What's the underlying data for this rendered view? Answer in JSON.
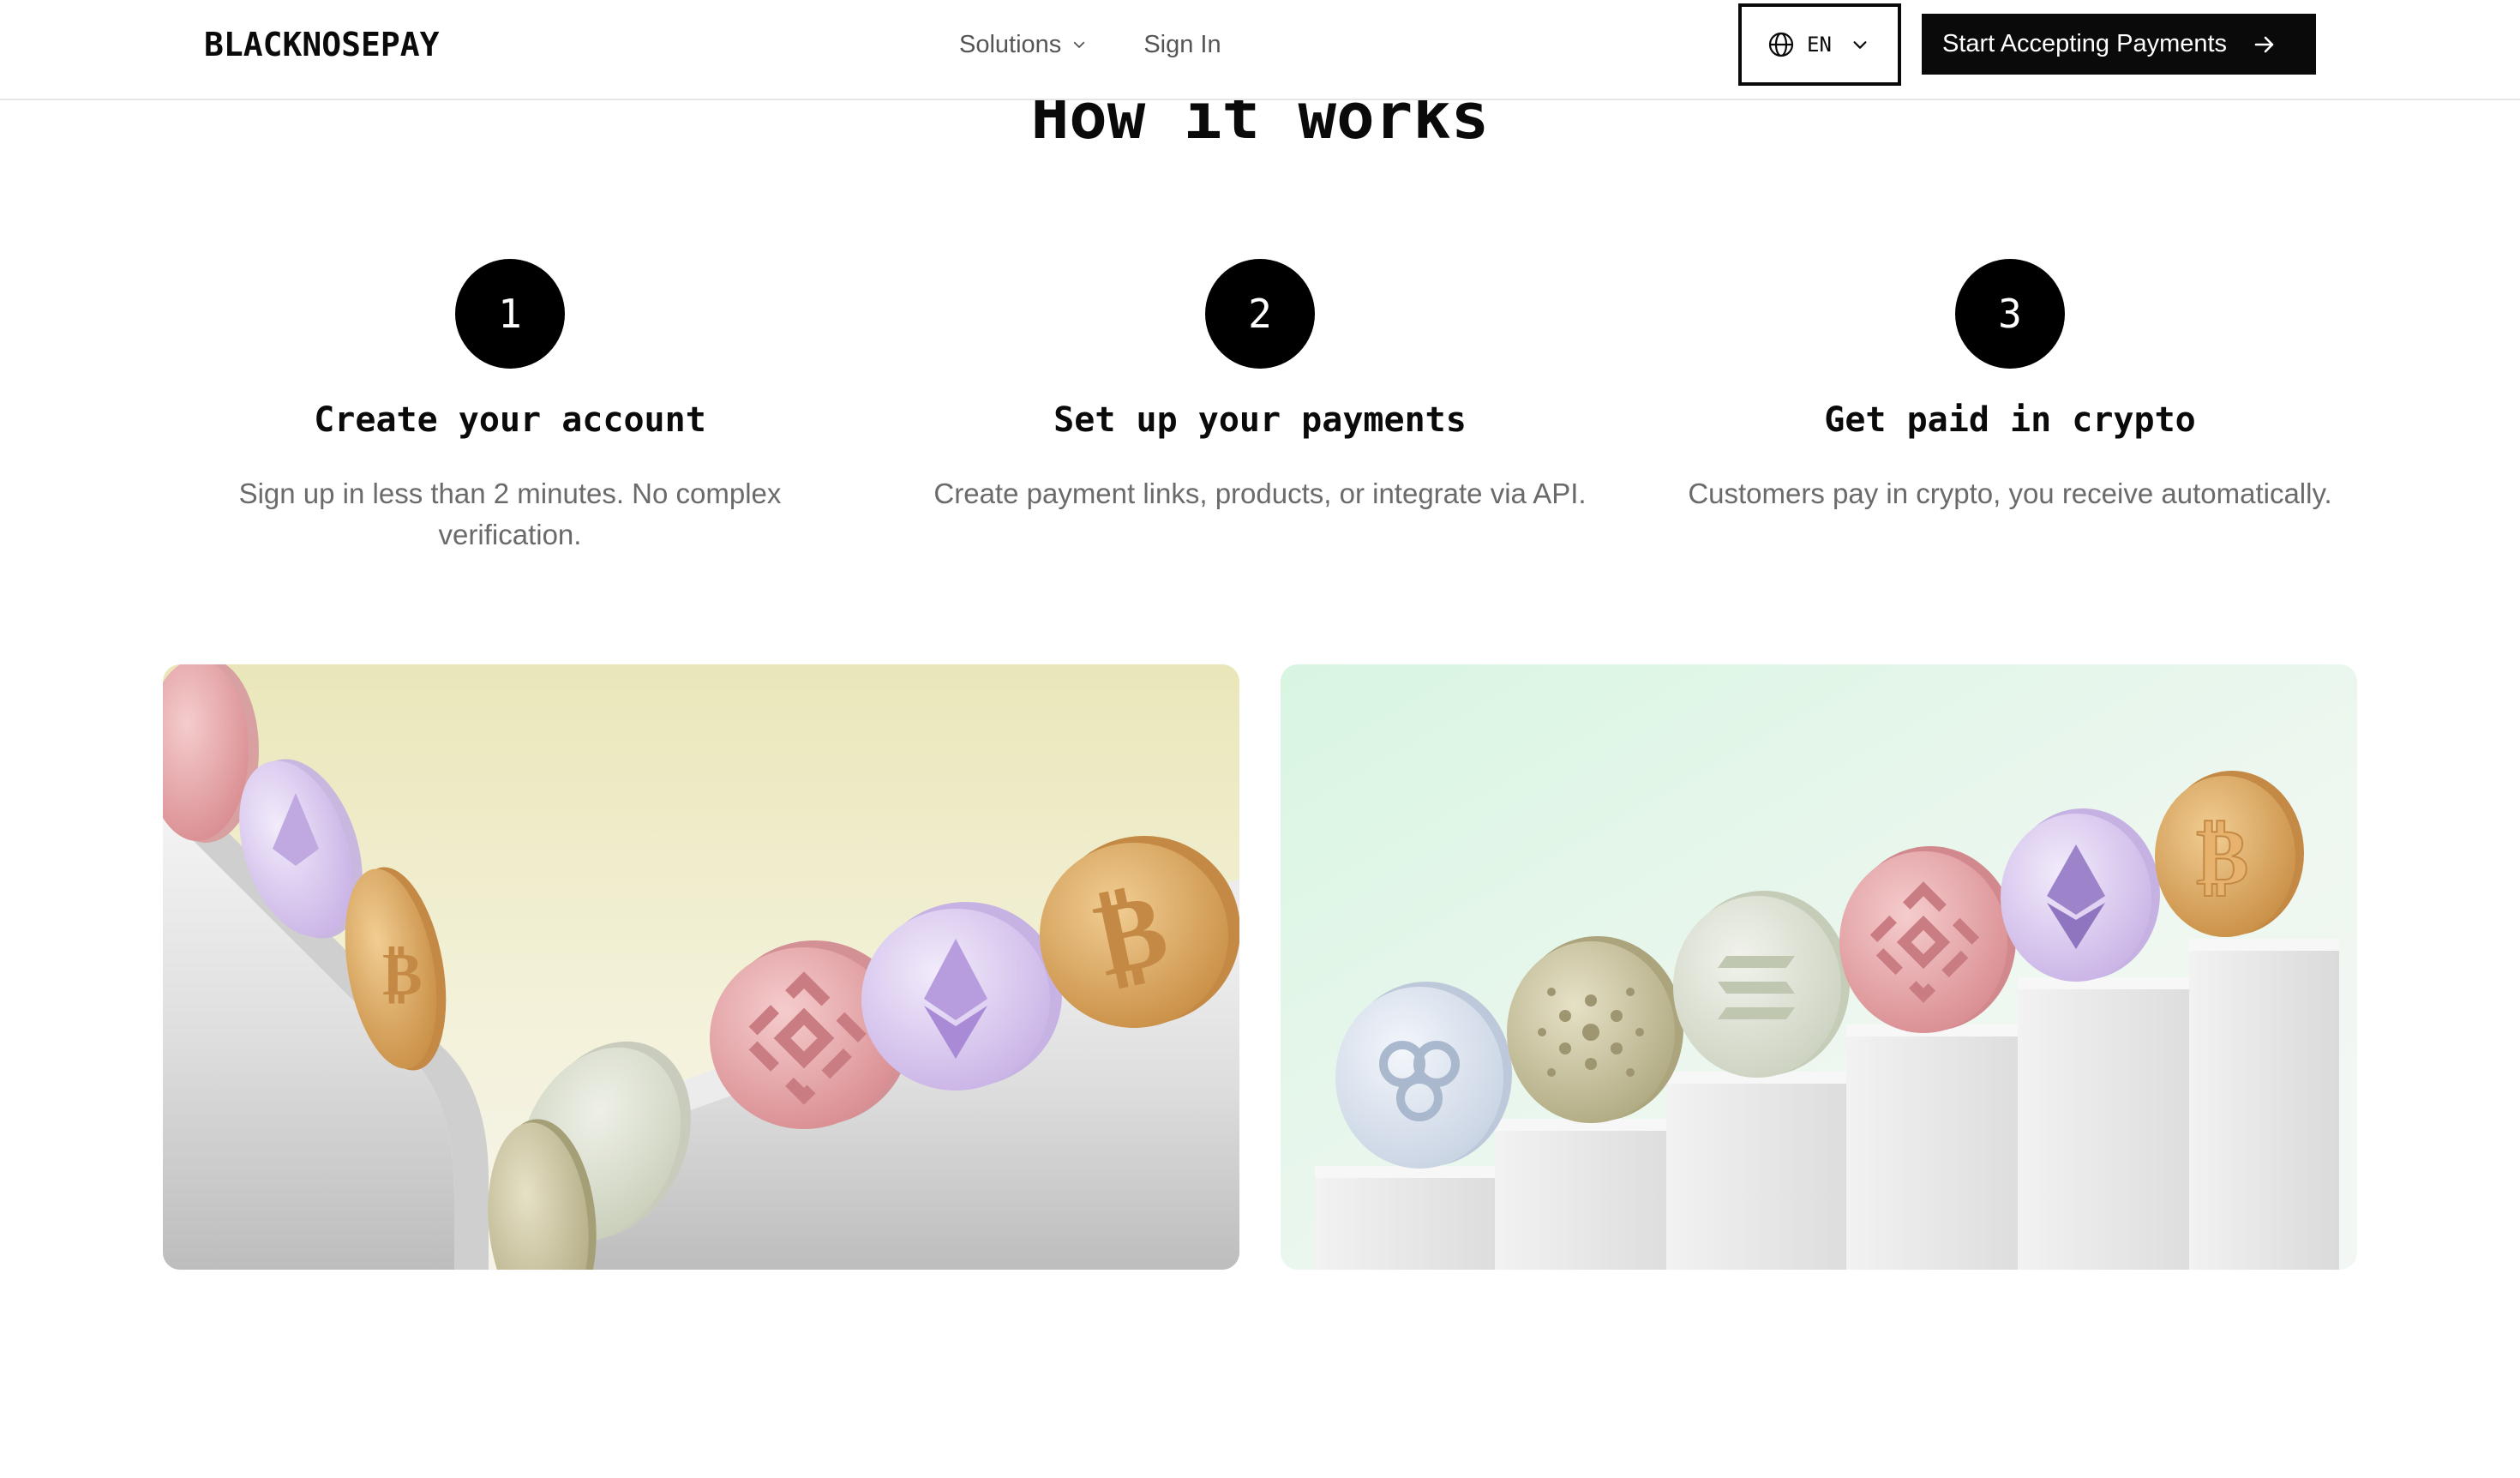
{
  "header": {
    "logo": "BLACKNOSEPAY",
    "nav": {
      "solutions_label": "Solutions",
      "signin_label": "Sign In"
    },
    "language": {
      "code": "EN",
      "icon": "globe-icon"
    },
    "cta_label": "Start Accepting Payments",
    "cta_icon": "arrow-right-icon"
  },
  "how_it_works": {
    "title": "How it works",
    "steps": [
      {
        "number": "1",
        "title": "Create your account",
        "description": "Sign up in less than 2 minutes. No complex verification."
      },
      {
        "number": "2",
        "title": "Set up your payments",
        "description": "Create payment links, products, or integrate via API."
      },
      {
        "number": "3",
        "title": "Get paid in crypto",
        "description": "Customers pay in crypto, you receive automatically."
      }
    ]
  },
  "illustrations": {
    "left": {
      "icon": "crypto-coins-on-slide-illustration",
      "colors": {
        "bg_top": "#e9e7b9",
        "bg_bottom": "#f6f4ea"
      }
    },
    "right": {
      "icon": "crypto-coins-on-podiums-illustration",
      "colors": {
        "bg_top": "#d8f5e2",
        "bg_bottom": "#f3f7f4"
      }
    }
  },
  "theme": {
    "primary": "#0a0a0a",
    "muted_text": "#6a6a6a",
    "nav_text": "#555555",
    "coin_colors": {
      "bitcoin": "#d9a766",
      "ethereum": "#d8c8ee",
      "bnb": "#e7a3a6",
      "solana": "#dfe4d6",
      "cardano": "#cfc9a8",
      "ripple": "#dde5f0"
    }
  }
}
